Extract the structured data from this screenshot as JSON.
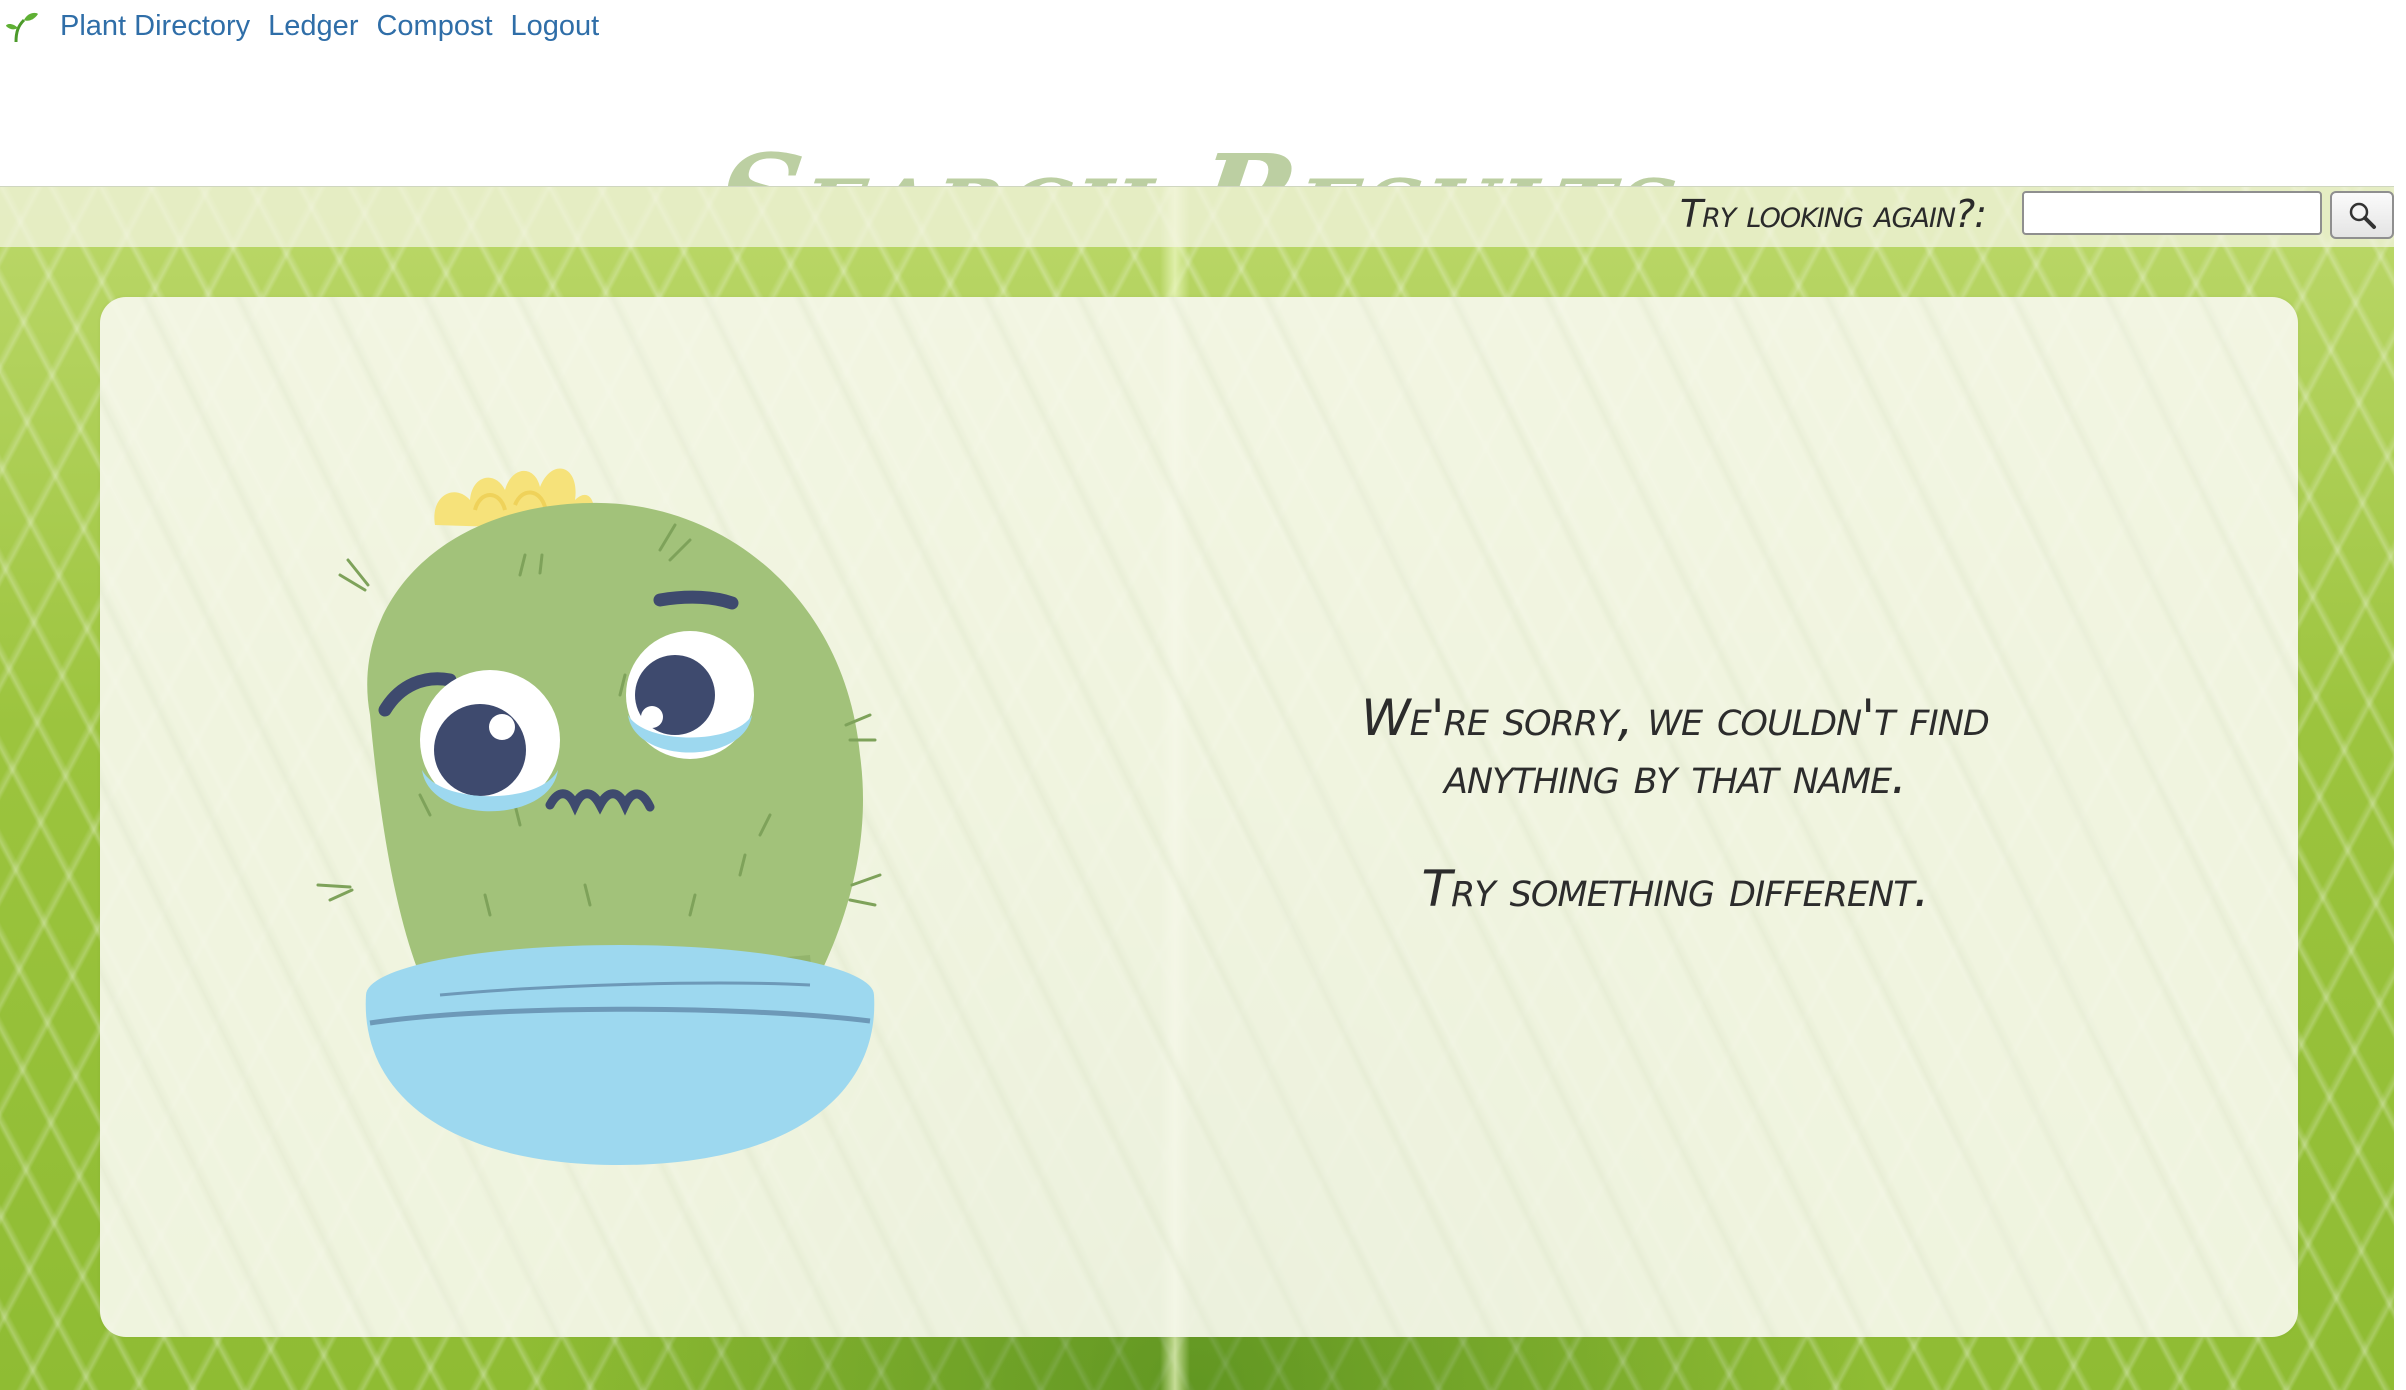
{
  "nav": {
    "items": [
      {
        "label": "Plant Directory"
      },
      {
        "label": "Ledger"
      },
      {
        "label": "Compost"
      },
      {
        "label": "Logout"
      }
    ]
  },
  "page": {
    "title": "Search Results"
  },
  "search": {
    "label": "Try looking again?:",
    "value": "",
    "placeholder": "",
    "button_icon": "magnifier-icon"
  },
  "message": {
    "line1": "We're sorry, we couldn't find",
    "line2": "anything by that name.",
    "line3": "Try something different."
  },
  "colors": {
    "nav_link": "#2f6ea8",
    "title": "#bccfa2",
    "cactus_body": "#a2c27a",
    "pot": "#9dd8ef",
    "flower": "#f6e27a",
    "text": "#2c2c2c"
  }
}
